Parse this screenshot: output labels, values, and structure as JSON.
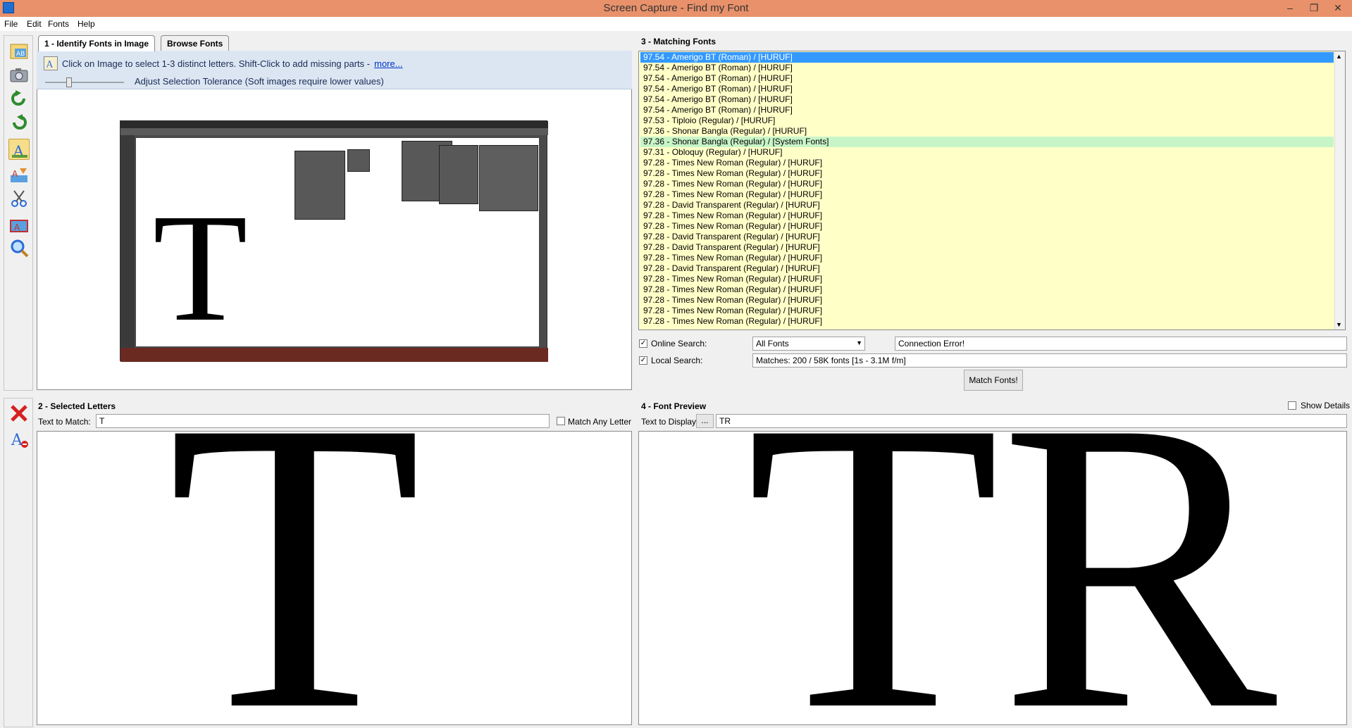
{
  "window": {
    "title": "Screen Capture - Find my Font",
    "controls": [
      "–",
      "❐",
      "✕"
    ]
  },
  "menu": [
    "File",
    "Edit",
    "Fonts",
    "Help"
  ],
  "tabs": [
    {
      "label": "1 - Identify Fonts in Image",
      "active": true
    },
    {
      "label": "Browse Fonts",
      "active": false
    }
  ],
  "identify": {
    "hint": "Click on Image to select 1-3 distinct letters. Shift-Click to add missing parts -",
    "more_link": "more...",
    "tolerance_label": "Adjust Selection Tolerance (Soft images require lower values)",
    "big_letter": "T"
  },
  "selected_letters": {
    "header": "2 - Selected Letters",
    "text_label": "Text to Match:",
    "text_value": "T",
    "match_any_label": "Match Any Letter",
    "match_any_checked": false,
    "letter": "T"
  },
  "matching": {
    "header": "3 - Matching Fonts",
    "rows": [
      {
        "text": "97.54 - Amerigo BT (Roman) / [HURUF]",
        "state": "selected"
      },
      {
        "text": "97.54 - Amerigo BT (Roman) / [HURUF]",
        "state": ""
      },
      {
        "text": "97.54 - Amerigo BT (Roman) / [HURUF]",
        "state": ""
      },
      {
        "text": "97.54 - Amerigo BT (Roman) / [HURUF]",
        "state": ""
      },
      {
        "text": "97.54 - Amerigo BT (Roman) / [HURUF]",
        "state": ""
      },
      {
        "text": "97.54 - Amerigo BT (Roman) / [HURUF]",
        "state": ""
      },
      {
        "text": "97.53 - Tiploio (Regular) / [HURUF]",
        "state": ""
      },
      {
        "text": "97.36 - Shonar Bangla (Regular) / [HURUF]",
        "state": ""
      },
      {
        "text": "97.36 - Shonar Bangla (Regular) / [System Fonts]",
        "state": "system"
      },
      {
        "text": "97.31 - Obloquy (Regular) / [HURUF]",
        "state": ""
      },
      {
        "text": "97.28 - Times New Roman (Regular) / [HURUF]",
        "state": ""
      },
      {
        "text": "97.28 - Times New Roman (Regular) / [HURUF]",
        "state": ""
      },
      {
        "text": "97.28 - Times New Roman (Regular) / [HURUF]",
        "state": ""
      },
      {
        "text": "97.28 - Times New Roman (Regular) / [HURUF]",
        "state": ""
      },
      {
        "text": "97.28 - David Transparent (Regular) / [HURUF]",
        "state": ""
      },
      {
        "text": "97.28 - Times New Roman (Regular) / [HURUF]",
        "state": ""
      },
      {
        "text": "97.28 - Times New Roman (Regular) / [HURUF]",
        "state": ""
      },
      {
        "text": "97.28 - David Transparent (Regular) / [HURUF]",
        "state": ""
      },
      {
        "text": "97.28 - David Transparent (Regular) / [HURUF]",
        "state": ""
      },
      {
        "text": "97.28 - Times New Roman (Regular) / [HURUF]",
        "state": ""
      },
      {
        "text": "97.28 - David Transparent (Regular) / [HURUF]",
        "state": ""
      },
      {
        "text": "97.28 - Times New Roman (Regular) / [HURUF]",
        "state": ""
      },
      {
        "text": "97.28 - Times New Roman (Regular) / [HURUF]",
        "state": ""
      },
      {
        "text": "97.28 - Times New Roman (Regular) / [HURUF]",
        "state": ""
      },
      {
        "text": "97.28 - Times New Roman (Regular) / [HURUF]",
        "state": ""
      },
      {
        "text": "97.28 - Times New Roman (Regular) / [HURUF]",
        "state": ""
      }
    ],
    "online_label": "Online Search:",
    "online_checked": true,
    "online_select": "All Fonts",
    "online_status": "Connection Error!",
    "local_label": "Local Search:",
    "local_checked": true,
    "local_status": "Matches: 200 / 58K fonts [1s - 3.1M f/m]",
    "match_button": "Match Fonts!"
  },
  "preview": {
    "header": "4 - Font Preview",
    "show_details_label": "Show Details",
    "show_details_checked": false,
    "text_label": "Text to Display:",
    "ellipsis_button": "...",
    "text_value": "TR",
    "sample": "TR"
  },
  "tools_top": [
    "capture-ab-icon",
    "camera-icon",
    "undo-icon",
    "redo-icon",
    "select-letters-icon",
    "adjust-icon",
    "crop-icon",
    "fix-image-icon",
    "zoom-icon"
  ],
  "tools_bottom": [
    "delete-icon",
    "letter-edit-icon"
  ]
}
